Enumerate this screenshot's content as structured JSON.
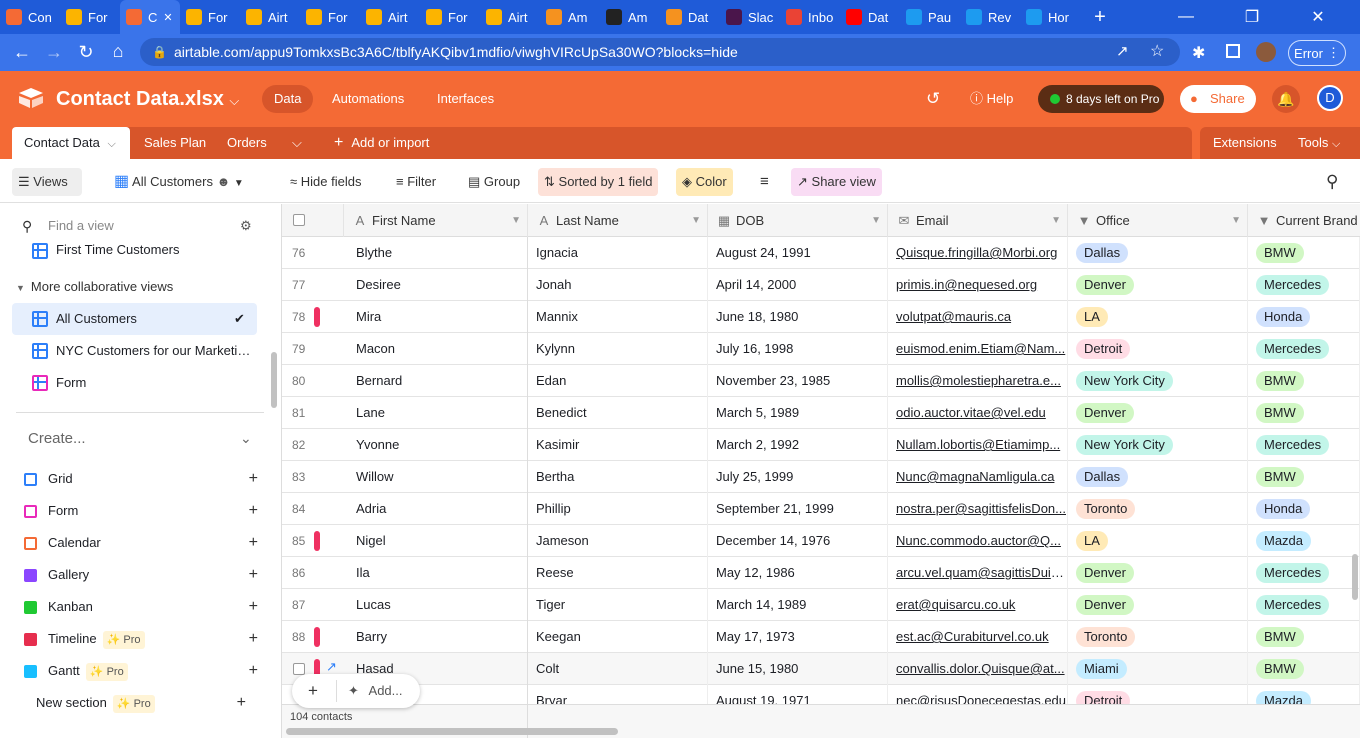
{
  "browser": {
    "tabs": [
      {
        "label": "Con",
        "icon": "coda-icon",
        "color": "#f46a35"
      },
      {
        "label": "For",
        "icon": "airtable-icon",
        "color": "#fcb400"
      },
      {
        "label": "C",
        "icon": "coda-icon",
        "color": "#f46a35",
        "active": true
      },
      {
        "label": "For",
        "icon": "airtable-icon",
        "color": "#fcb400"
      },
      {
        "label": "Airt",
        "icon": "airtable-icon",
        "color": "#fcb400"
      },
      {
        "label": "For",
        "icon": "airtable-icon",
        "color": "#fcb400"
      },
      {
        "label": "Airt",
        "icon": "airtable-icon",
        "color": "#fcb400"
      },
      {
        "label": "For",
        "icon": "airtable-icon",
        "color": "#fcb400"
      },
      {
        "label": "Airt",
        "icon": "airtable-icon",
        "color": "#fcb400"
      },
      {
        "label": "Am",
        "icon": "aws-icon",
        "color": "#f5921f"
      },
      {
        "label": "Am",
        "icon": "amazon-icon",
        "color": "#222222"
      },
      {
        "label": "Dat",
        "icon": "aws-icon",
        "color": "#f5921f"
      },
      {
        "label": "Slac",
        "icon": "slack-icon",
        "color": "#4a154b"
      },
      {
        "label": "Inbo",
        "icon": "gmail-icon",
        "color": "#ea4335"
      },
      {
        "label": "Dat",
        "icon": "youtube-icon",
        "color": "#ff0000"
      },
      {
        "label": "Pau",
        "icon": "twitter-icon",
        "color": "#1d9bf0"
      },
      {
        "label": "Rev",
        "icon": "twitter-icon",
        "color": "#1d9bf0"
      },
      {
        "label": "Hor",
        "icon": "twitter-icon",
        "color": "#1d9bf0"
      }
    ],
    "url": "airtable.com/appu9TomkxsBc3A6C/tblfyAKQibv1mdfio/viwghVIRcUpSa30WO?blocks=hide",
    "error_label": "Error"
  },
  "header": {
    "base_name": "Contact Data.xlsx",
    "nav": [
      "Data",
      "Automations",
      "Interfaces"
    ],
    "help": "Help",
    "trial": "8 days left on Pro",
    "share": "Share",
    "avatar": "D"
  },
  "tables": {
    "tabs": [
      "Contact Data",
      "Sales Plan",
      "Orders"
    ],
    "add": "Add or import",
    "extensions": "Extensions",
    "tools": "Tools"
  },
  "viewbar": {
    "views": "Views",
    "view_name": "All Customers",
    "hide_fields": "Hide fields",
    "filter": "Filter",
    "group": "Group",
    "sorted": "Sorted by 1 field",
    "color": "Color",
    "share_view": "Share view"
  },
  "sidebar": {
    "find_placeholder": "Find a view",
    "first_time": "First Time Customers",
    "section": "More collaborative views",
    "views": [
      "All Customers",
      "NYC Customers for our Marketing...",
      "Form"
    ],
    "create": "Create...",
    "create_items": [
      "Grid",
      "Form",
      "Calendar",
      "Gallery",
      "Kanban",
      "Timeline",
      "Gantt"
    ],
    "pro": "Pro",
    "new_section": "New section"
  },
  "grid": {
    "columns": [
      "First Name",
      "Last Name",
      "DOB",
      "Email",
      "Office",
      "Current Brand"
    ],
    "rows": [
      {
        "n": "76",
        "first": "Blythe",
        "last": "Ignacia",
        "dob": "August 24, 1991",
        "email": "Quisque.fringilla@Morbi.org",
        "office": "Dallas",
        "brand": "BMW",
        "flag": false
      },
      {
        "n": "77",
        "first": "Desiree",
        "last": "Jonah",
        "dob": "April 14, 2000",
        "email": "primis.in@nequesed.org",
        "office": "Denver",
        "brand": "Mercedes",
        "flag": false
      },
      {
        "n": "78",
        "first": "Mira",
        "last": "Mannix",
        "dob": "June 18, 1980",
        "email": "volutpat@mauris.ca",
        "office": "LA",
        "brand": "Honda",
        "flag": true
      },
      {
        "n": "79",
        "first": "Macon",
        "last": "Kylynn",
        "dob": "July 16, 1998",
        "email": "euismod.enim.Etiam@Nam...",
        "office": "Detroit",
        "brand": "Mercedes",
        "flag": false
      },
      {
        "n": "80",
        "first": "Bernard",
        "last": "Edan",
        "dob": "November 23, 1985",
        "email": "mollis@molestiepharetra.e...",
        "office": "New York City",
        "brand": "BMW",
        "flag": false
      },
      {
        "n": "81",
        "first": "Lane",
        "last": "Benedict",
        "dob": "March 5, 1989",
        "email": "odio.auctor.vitae@vel.edu",
        "office": "Denver",
        "brand": "BMW",
        "flag": false
      },
      {
        "n": "82",
        "first": "Yvonne",
        "last": "Kasimir",
        "dob": "March 2, 1992",
        "email": "Nullam.lobortis@Etiamimp...",
        "office": "New York City",
        "brand": "Mercedes",
        "flag": false
      },
      {
        "n": "83",
        "first": "Willow",
        "last": "Bertha",
        "dob": "July 25, 1999",
        "email": "Nunc@magnaNamligula.ca",
        "office": "Dallas",
        "brand": "BMW",
        "flag": false
      },
      {
        "n": "84",
        "first": "Adria",
        "last": "Phillip",
        "dob": "September 21, 1999",
        "email": "nostra.per@sagittisfelisDon...",
        "office": "Toronto",
        "brand": "Honda",
        "flag": false
      },
      {
        "n": "85",
        "first": "Nigel",
        "last": "Jameson",
        "dob": "December 14, 1976",
        "email": "Nunc.commodo.auctor@Q...",
        "office": "LA",
        "brand": "Mazda",
        "flag": true
      },
      {
        "n": "86",
        "first": "Ila",
        "last": "Reese",
        "dob": "May 12, 1986",
        "email": "arcu.vel.quam@sagittisDuis...",
        "office": "Denver",
        "brand": "Mercedes",
        "flag": false
      },
      {
        "n": "87",
        "first": "Lucas",
        "last": "Tiger",
        "dob": "March 14, 1989",
        "email": "erat@quisarcu.co.uk",
        "office": "Denver",
        "brand": "Mercedes",
        "flag": false
      },
      {
        "n": "88",
        "first": "Barry",
        "last": "Keegan",
        "dob": "May 17, 1973",
        "email": "est.ac@Curabiturvel.co.uk",
        "office": "Toronto",
        "brand": "BMW",
        "flag": true
      },
      {
        "n": "",
        "first": "Hasad",
        "last": "Colt",
        "dob": "June 15, 1980",
        "email": "convallis.dolor.Quisque@at...",
        "office": "Miami",
        "brand": "BMW",
        "flag": true
      },
      {
        "n": "",
        "first": "",
        "last": "Bryar",
        "dob": "August 19, 1971",
        "email": "nec@risusDonecegestas.edu",
        "office": "Detroit",
        "brand": "Mazda",
        "flag": false
      }
    ],
    "office_colors": {
      "Dallas": "#d0e1fd",
      "Denver": "#d1f7c4",
      "LA": "#ffeab6",
      "Detroit": "#ffdce5",
      "New York City": "#c2f5e9",
      "Toronto": "#fee2d5",
      "Miami": "#c4ecff"
    },
    "brand_colors": {
      "BMW": "#d1f7c4",
      "Mercedes": "#c2f5e9",
      "Honda": "#d0e1fd",
      "Mazda": "#c4ecff"
    },
    "add_label": "Add...",
    "footer": "104 contacts"
  }
}
